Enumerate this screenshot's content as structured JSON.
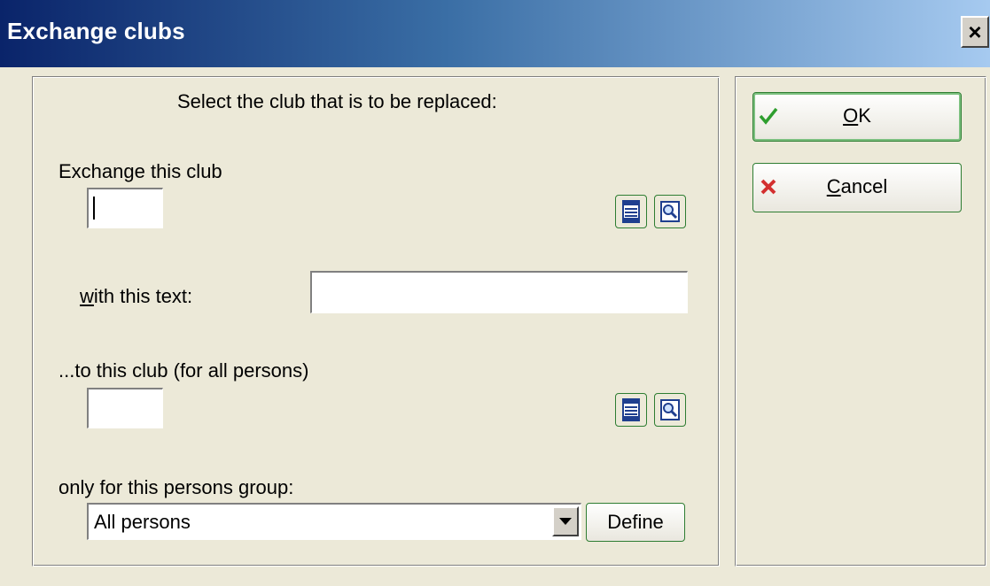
{
  "window": {
    "title": "Exchange clubs",
    "close_label": "×"
  },
  "form": {
    "heading": "Select the club that is to be replaced:",
    "exchange_label": "Exchange this club",
    "exchange_value": "",
    "with_text_label_rest": "ith this text:",
    "with_text_label_mnemonic": "w",
    "with_text_value": "",
    "to_club_label": "...to this club (for all persons)",
    "to_club_value": "",
    "group_label": "only for this persons group:",
    "group_selected": "All persons",
    "define_label": "Define"
  },
  "buttons": {
    "ok_mnemonic": "O",
    "ok_rest": "K",
    "cancel_mnemonic": "C",
    "cancel_rest": "ancel"
  },
  "icons": {
    "list": "list-icon",
    "search": "search-icon",
    "ok": "checkmark-icon",
    "cancel": "x-mark-icon"
  },
  "colors": {
    "accent_border": "#2e7d32",
    "ok_check": "#2e9e2e",
    "cancel_x": "#d32f2f",
    "title_start": "#0a246a",
    "title_end": "#a6caf0"
  }
}
